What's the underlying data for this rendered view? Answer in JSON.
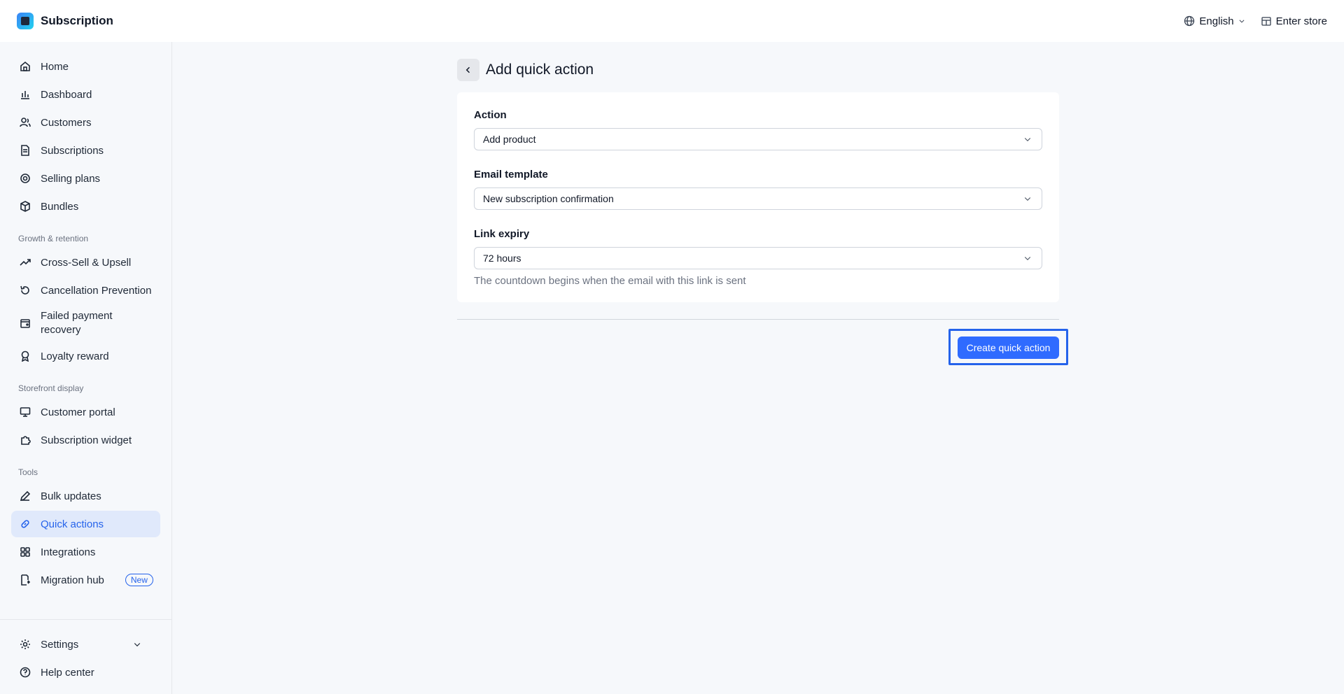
{
  "app": {
    "title": "Subscription"
  },
  "topbar": {
    "language": "English",
    "enter_store": "Enter store"
  },
  "sidebar": {
    "main": [
      {
        "label": "Home"
      },
      {
        "label": "Dashboard"
      },
      {
        "label": "Customers"
      },
      {
        "label": "Subscriptions"
      },
      {
        "label": "Selling plans"
      },
      {
        "label": "Bundles"
      }
    ],
    "growth_title": "Growth & retention",
    "growth": [
      {
        "label": "Cross-Sell & Upsell"
      },
      {
        "label": "Cancellation Prevention"
      },
      {
        "label": "Failed payment recovery"
      },
      {
        "label": "Loyalty reward"
      }
    ],
    "storefront_title": "Storefront display",
    "storefront": [
      {
        "label": "Customer portal"
      },
      {
        "label": "Subscription widget"
      }
    ],
    "tools_title": "Tools",
    "tools": [
      {
        "label": "Bulk updates"
      },
      {
        "label": "Quick actions"
      },
      {
        "label": "Integrations"
      },
      {
        "label": "Migration hub",
        "badge": "New"
      }
    ],
    "bottom": [
      {
        "label": "Settings"
      },
      {
        "label": "Help center"
      }
    ]
  },
  "page": {
    "title": "Add quick action",
    "action_label": "Action",
    "action_value": "Add product",
    "email_label": "Email template",
    "email_value": "New subscription confirmation",
    "expiry_label": "Link expiry",
    "expiry_value": "72 hours",
    "expiry_helper": "The countdown begins when the email with this link is sent",
    "submit_label": "Create quick action"
  },
  "colors": {
    "accent": "#2f6bff",
    "active_bg": "#e0e9fb"
  }
}
